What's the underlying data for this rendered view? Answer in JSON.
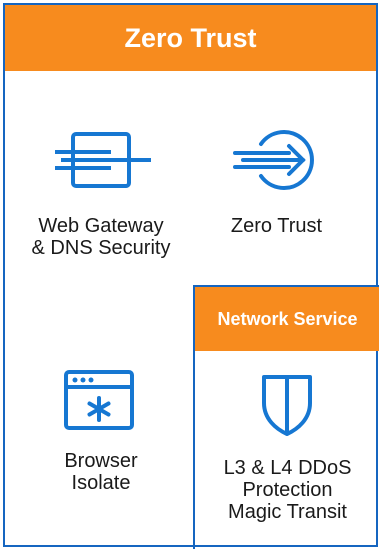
{
  "header": {
    "title": "Zero Trust"
  },
  "items": {
    "web_gateway": {
      "line1": "Web Gateway",
      "line2": "& DNS Security",
      "icon": "gateway-icon"
    },
    "zero_trust": {
      "label": "Zero Trust",
      "icon": "circle-arrow-icon"
    },
    "browser_isolate": {
      "line1": "Browser",
      "line2": "Isolate",
      "icon": "browser-window-icon"
    }
  },
  "network_service": {
    "title": "Network Service",
    "ddos": {
      "line1": "L3 & L4 DDoS",
      "line2": "Protection",
      "line3": "Magic Transit",
      "icon": "shield-icon"
    }
  },
  "colors": {
    "accent_orange": "#f78b1e",
    "border_blue": "#1565c0",
    "icon_blue": "#1677d2"
  }
}
